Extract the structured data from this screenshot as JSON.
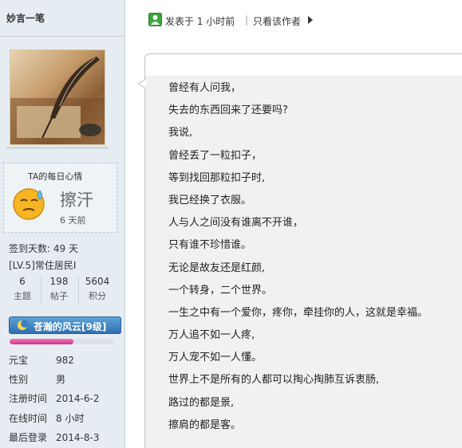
{
  "sidebar": {
    "username": "妙言一笔",
    "mood": {
      "title": "TA的每日心情",
      "text": "擦汗",
      "time": "6 天前"
    },
    "checkin": "签到天数: 49 天",
    "level": "[LV.5]常住居民I",
    "stats": [
      {
        "num": "6",
        "label": "主题"
      },
      {
        "num": "198",
        "label": "帖子"
      },
      {
        "num": "5604",
        "label": "积分"
      }
    ],
    "group": "苍瀚的风云[9级]",
    "exp_percent": 61,
    "info": [
      {
        "key": "元宝",
        "value": "982"
      },
      {
        "key": "性别",
        "value": "男"
      },
      {
        "key": "注册时间",
        "value": "2014-6-2"
      },
      {
        "key": "在线时间",
        "value": "8 小时"
      },
      {
        "key": "最后登录",
        "value": "2014-8-3"
      }
    ]
  },
  "post": {
    "time": "发表于 1 小时前",
    "separator": "|",
    "only_author": "只看该作者",
    "lines": [
      "曾经有人问我，",
      "失去的东西回来了还要吗?",
      "我说,",
      "曾经丢了一粒扣子，",
      "等到找回那粒扣子时,",
      "我已经换了衣服。",
      "人与人之间没有谁离不开谁，",
      "只有谁不珍惜谁。",
      "无论是故友还是红颜,",
      "一个转身，二个世界。",
      "一生之中有一个爱你，疼你，牵挂你的人，这就是幸福。",
      "万人追不如一人疼,",
      "万人宠不如一人懂。",
      "世界上不是所有的人都可以掏心掏肺互诉衷肠,",
      "路过的都是景,",
      "擦肩的都是客。"
    ]
  },
  "colors": {
    "sidebar_bg": "#e5edf2",
    "group_badge": "#2d6fb0",
    "exp_bar": "#e0409a",
    "post_icon": "#2e9a2e"
  }
}
